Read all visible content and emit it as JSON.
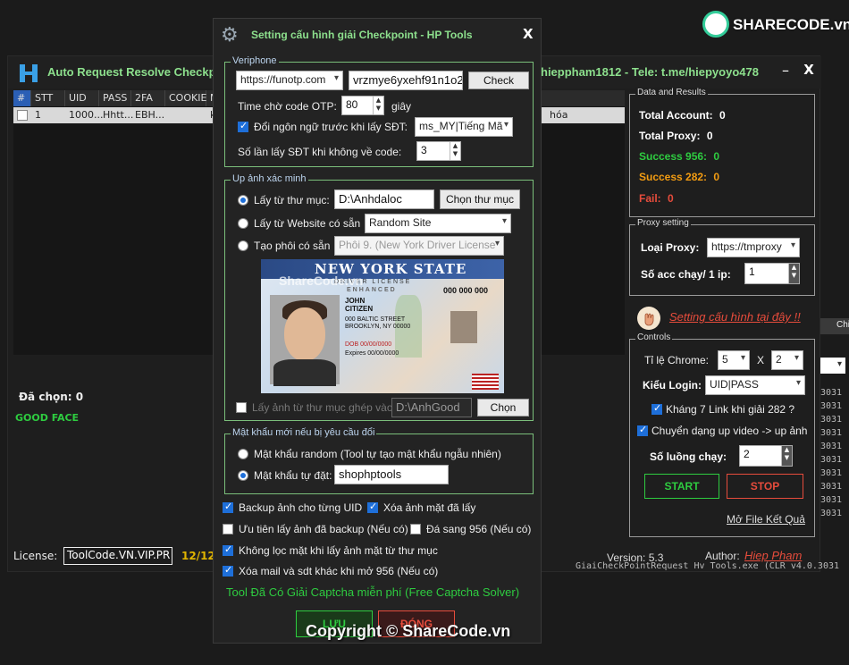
{
  "main": {
    "title_left": "Auto Request Resolve Checkpo",
    "title_right": "hieppham1812 - Tele: t.me/hiepyoyo478",
    "minimize": "–",
    "close": "X",
    "grid": {
      "headers": [
        "#",
        "STT",
        "UID",
        "PASS",
        "2FA",
        "COOKIE",
        "M"
      ],
      "row": [
        "1",
        "1000...",
        "Hhtt...",
        "EBH...",
        "ku"
      ],
      "row_tail": "hóa"
    },
    "selected_label": "Đã chọn:",
    "selected_count": "0",
    "good_face": "GOOD FACE",
    "license_label": "License:",
    "license_value": "ToolCode.VN.VIP.PR",
    "license_count": "12/12",
    "version": "Version: 5.3",
    "author_label": "Author:",
    "author_name": "Hiep Pham",
    "partial_tab": "Chi"
  },
  "results": {
    "title": "Data and Results",
    "total_account_label": "Total Account:",
    "total_account": "0",
    "total_proxy_label": "Total Proxy:",
    "total_proxy": "0",
    "success956_label": "Success 956:",
    "success956": "0",
    "success282_label": "Success 282:",
    "success282": "0",
    "fail_label": "Fail:",
    "fail": "0"
  },
  "proxy": {
    "title": "Proxy setting",
    "type_label": "Loại Proxy:",
    "type_value": "https://tmproxy",
    "per_ip_label": "Số acc chạy/ 1 ip:",
    "per_ip_value": "1"
  },
  "setting_link": "Setting cấu hình tại đây !!",
  "controls": {
    "title": "Controls",
    "chrome_ratio_label": "Tỉ lệ Chrome:",
    "chrome_ratio_a": "5",
    "x": "X",
    "chrome_ratio_b": "2",
    "login_label": "Kiểu Login:",
    "login_value": "UID|PASS",
    "kh7_label": "Kháng 7 Link khi giải 282 ?",
    "video_label": "Chuyển dạng up video -> up ảnh",
    "threads_label": "Số luồng chạy:",
    "threads_value": "2",
    "start": "START",
    "stop": "STOP",
    "open_result": "Mở File Kết Quả"
  },
  "log": {
    "prefix": "3031",
    "lines": [
      "3031",
      "3031",
      "3031",
      "3031",
      "3031",
      "3031",
      "3031",
      "3031",
      "3031",
      "3031"
    ],
    "bottom_line": "GiaiCheckPointRequest   Hv Tools.exe   (CLR v4.0.3031"
  },
  "dialog": {
    "title": "Setting cấu hình giải Checkpoint - HP Tools",
    "close": "X",
    "veriphone": {
      "title": "Veriphone",
      "site": "https://funotp.com",
      "key": "vrzmye6yxehf91n1o2",
      "check": "Check",
      "otp_wait_label": "Time chờ code OTP:",
      "otp_wait_value": "80",
      "otp_unit": "giây",
      "change_lang_label": "Đổi ngôn ngữ trước khi lấy SĐT:",
      "lang_value": "ms_MY|Tiếng Mã",
      "retry_label": "Số lần lấy SĐT khi không về code:",
      "retry_value": "3"
    },
    "upload": {
      "title": "Up ảnh xác minh",
      "from_folder_label": "Lấy từ thư mục:",
      "from_folder_value": "D:\\Anhdaloc",
      "choose_folder": "Chọn thư mục",
      "from_site_label": "Lấy từ Website có sẵn",
      "site_value": "Random Site",
      "make_embryo_label": "Tạo phôi có sẵn",
      "embryo_value": "Phôi 9. (New York Driver License",
      "merge_label": "Lấy ảnh từ thư mục ghép vào:",
      "merge_value": "D:\\AnhGood",
      "merge_choose": "Chọn"
    },
    "card": {
      "state": "NEW YORK STATE",
      "sub": "DRIVER LICENSE",
      "sub2": "ENHANCED",
      "number": "000 000 000",
      "name1": "JOHN",
      "name2": "CITIZEN",
      "addr1": "000 BALTIC STREET",
      "addr2": "BROOKLYN, NY 00000",
      "dob": "DOB 00/00/0000",
      "exp": "Expires 00/00/0000",
      "watermark": "ShareCode.vn"
    },
    "password": {
      "title": "Mật khẩu mới nếu bị yêu cầu đổi",
      "random_label": "Mật khẩu random (Tool tự tạo mật khẩu ngẫu nhiên)",
      "custom_label": "Mật khẩu tự đặt:",
      "custom_value": "shophptools"
    },
    "opt_backup": "Backup ảnh cho từng UID",
    "opt_delete_used": "Xóa ảnh mặt đã lấy",
    "opt_prefer_backup": "Ưu tiên lấy ảnh đã backup (Nếu có)",
    "opt_to956": "Đá sang 956 (Nếu có)",
    "opt_no_filter": "Không lọc mặt khi lấy ảnh mặt từ thư mục",
    "opt_delete_mail": "Xóa mail và sdt khác khi mở 956 (Nếu có)",
    "captcha_note": "Tool Đã Có Giải Captcha miễn phí (Free Captcha Solver)",
    "save": "LƯU",
    "close_btn": "ĐÓNG"
  },
  "brand": {
    "logo_text": "SHARECODE.vn",
    "copyright": "Copyright © ShareCode.vn"
  }
}
